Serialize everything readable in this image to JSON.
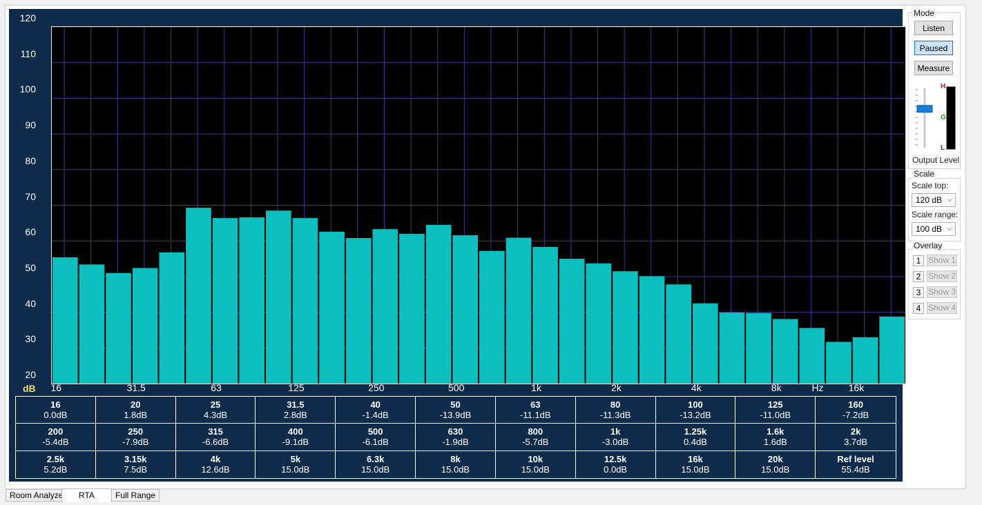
{
  "chart_data": {
    "type": "bar",
    "ylabel": "dB",
    "xunit": "Hz",
    "ylim": [
      20,
      120
    ],
    "yticks": [
      120,
      110,
      100,
      90,
      80,
      70,
      60,
      50,
      40,
      30,
      20
    ],
    "xticklabels": [
      "16",
      "31.5",
      "63",
      "125",
      "250",
      "500",
      "1k",
      "2k",
      "4k",
      "8k",
      "16k"
    ],
    "bar_color": "#0cbfbf",
    "grid_color": "#3c3a8c",
    "categories": [
      "16",
      "20",
      "25",
      "31.5",
      "40",
      "50",
      "63",
      "80",
      "100",
      "125",
      "160",
      "200",
      "250",
      "315",
      "400",
      "500",
      "630",
      "800",
      "1k",
      "1.25k",
      "1.6k",
      "2k",
      "2.5k",
      "3.15k",
      "4k",
      "5k",
      "6.3k",
      "8k",
      "10k",
      "12.5k",
      "16k",
      "20k"
    ],
    "values": [
      55.4,
      53.4,
      51.0,
      52.4,
      56.8,
      69.3,
      66.4,
      66.6,
      68.5,
      66.4,
      62.6,
      60.8,
      63.3,
      62.0,
      64.5,
      61.6,
      57.2,
      60.9,
      58.3,
      55.0,
      53.7,
      51.5,
      50.1,
      47.8,
      42.5,
      39.9,
      39.8,
      38.1,
      35.6,
      31.7,
      33.0,
      38.8
    ]
  },
  "table": [
    [
      "16",
      "0.0dB"
    ],
    [
      "20",
      "1.8dB"
    ],
    [
      "25",
      "4.3dB"
    ],
    [
      "31.5",
      "2.8dB"
    ],
    [
      "40",
      "-1.4dB"
    ],
    [
      "50",
      "-13.9dB"
    ],
    [
      "63",
      "-11.1dB"
    ],
    [
      "80",
      "-11.3dB"
    ],
    [
      "100",
      "-13.2dB"
    ],
    [
      "125",
      "-11.0dB"
    ],
    [
      "160",
      "-7.2dB"
    ],
    [
      "200",
      "-5.4dB"
    ],
    [
      "250",
      "-7.9dB"
    ],
    [
      "315",
      "-6.6dB"
    ],
    [
      "400",
      "-9.1dB"
    ],
    [
      "500",
      "-6.1dB"
    ],
    [
      "630",
      "-1.9dB"
    ],
    [
      "800",
      "-5.7dB"
    ],
    [
      "1k",
      "-3.0dB"
    ],
    [
      "1.25k",
      "0.4dB"
    ],
    [
      "1.6k",
      "1.6dB"
    ],
    [
      "2k",
      "3.7dB"
    ],
    [
      "2.5k",
      "5.2dB"
    ],
    [
      "3.15k",
      "7.5dB"
    ],
    [
      "4k",
      "12.6dB"
    ],
    [
      "5k",
      "15.0dB"
    ],
    [
      "6.3k",
      "15.0dB"
    ],
    [
      "8k",
      "15.0dB"
    ],
    [
      "10k",
      "15.0dB"
    ],
    [
      "12.5k",
      "0.0dB"
    ],
    [
      "16k",
      "15.0dB"
    ],
    [
      "20k",
      "15.0dB"
    ],
    [
      "Ref level",
      "55.4dB"
    ]
  ],
  "mode": {
    "label": "Mode",
    "listen": "Listen",
    "paused": "Paused",
    "measure": "Measure",
    "active": "paused"
  },
  "meter": {
    "h": "H",
    "g": "G",
    "l": "L",
    "output_level": "Output Level",
    "slider_level": 0.35
  },
  "scale": {
    "label": "Scale",
    "top_label": "Scale top:",
    "top_value": "120 dB",
    "range_label": "Scale range:",
    "range_value": "100 dB"
  },
  "overlay": {
    "label": "Overlay",
    "items": [
      {
        "num": "1",
        "show": "Show 1"
      },
      {
        "num": "2",
        "show": "Show 2"
      },
      {
        "num": "3",
        "show": "Show 3"
      },
      {
        "num": "4",
        "show": "Show 4"
      }
    ]
  },
  "tabs": [
    "Room Analyzer",
    "RTA",
    "Full Range"
  ]
}
